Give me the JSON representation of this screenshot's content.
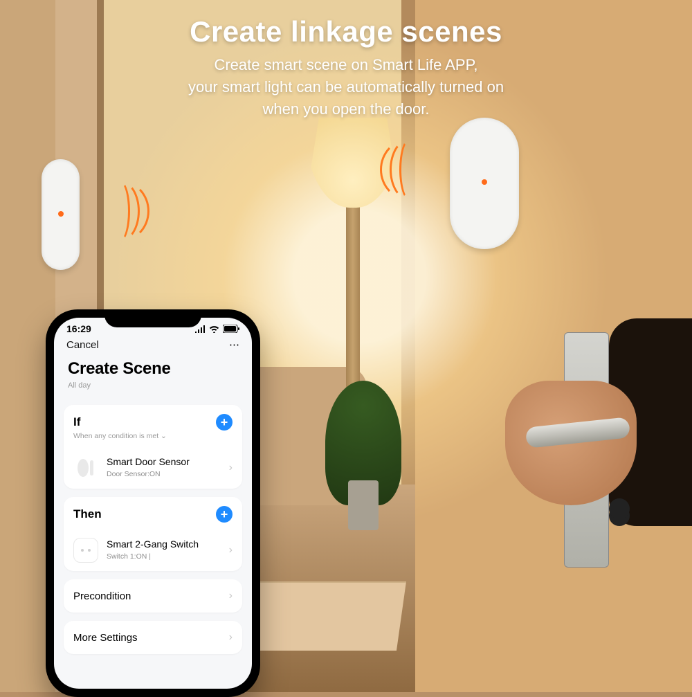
{
  "marketing": {
    "headline": "Create linkage scenes",
    "subhead": "Create smart scene on Smart Life APP,\nyour smart light can be automatically turned on\nwhen you open the door."
  },
  "phone": {
    "status": {
      "time": "16:29"
    },
    "nav": {
      "cancel": "Cancel"
    },
    "title": {
      "main": "Create Scene",
      "sub": "All day"
    },
    "sections": {
      "if": {
        "title": "If",
        "note": "When any condition is met ⌄"
      },
      "then": {
        "title": "Then"
      }
    },
    "conditions": [
      {
        "name": "Smart Door Sensor",
        "status": "Door Sensor:ON"
      }
    ],
    "actions": [
      {
        "name": "Smart 2-Gang Switch",
        "status": "Switch 1:ON  |"
      }
    ],
    "extras": {
      "precondition": "Precondition",
      "more": "More Settings"
    }
  }
}
